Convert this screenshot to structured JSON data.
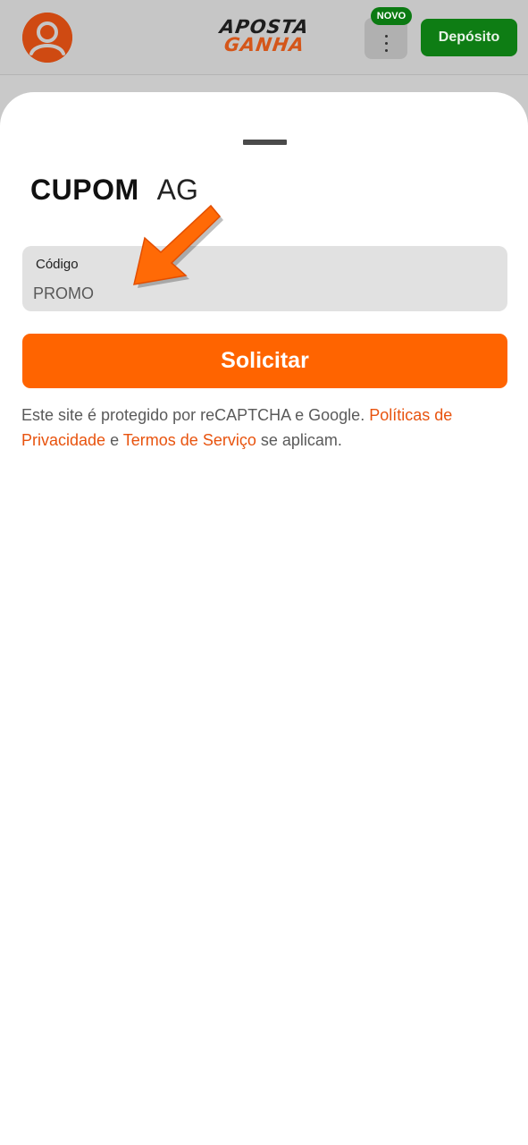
{
  "header": {
    "avatar_icon": "user-circle-icon",
    "logo_line1": "APOSTA",
    "logo_line2": "GANHA",
    "menu_icon": "kebab-menu-icon",
    "new_badge": "NOVO",
    "deposit_label": "Depósito"
  },
  "sheet": {
    "title_bold": "CUPOM",
    "title_light": "AG",
    "code_field": {
      "label": "Código",
      "value": "PROMO"
    },
    "submit_label": "Solicitar",
    "legal": {
      "text_before": "Este site é protegido por reCAPTCHA e Google.",
      "privacy_link": "Políticas de Privacidade",
      "conjunction": "e",
      "terms_link": "Termos de Serviço",
      "text_after": "se aplicam."
    },
    "annotation_icon": "arrow-pointer-icon"
  },
  "colors": {
    "accent": "#ff6400",
    "deposit_green": "#0e7d14",
    "link": "#e8530e",
    "field_bg": "#e1e1e1"
  }
}
